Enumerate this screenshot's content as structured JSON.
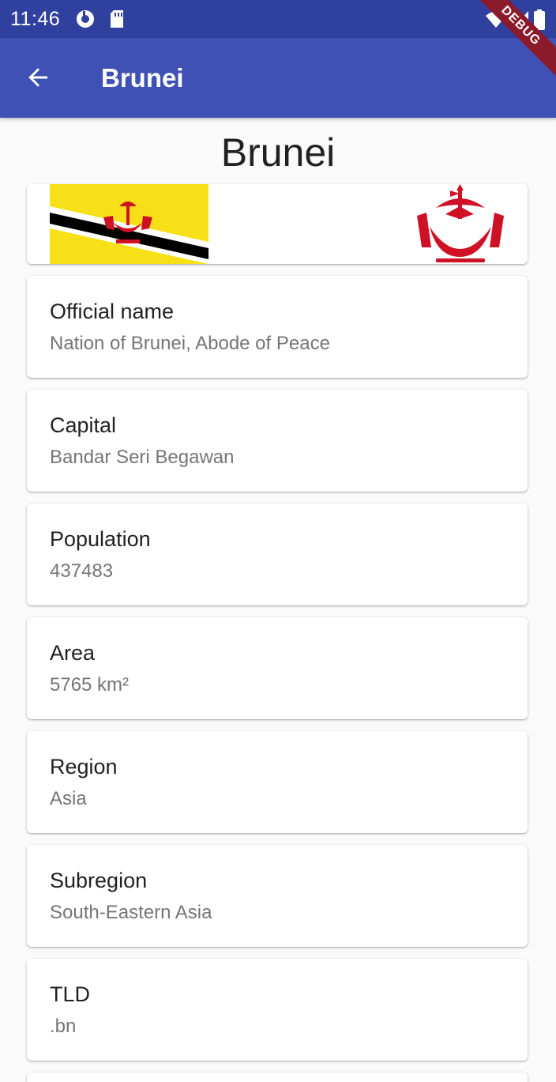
{
  "status_bar": {
    "time": "11:46"
  },
  "app_bar": {
    "title": "Brunei"
  },
  "debug_banner": "DEBUG",
  "heading": "Brunei",
  "fields": [
    {
      "label": "Official name",
      "value": "Nation of Brunei, Abode of Peace"
    },
    {
      "label": "Capital",
      "value": "Bandar Seri Begawan"
    },
    {
      "label": "Population",
      "value": "437483"
    },
    {
      "label": "Area",
      "value": "5765 km²"
    },
    {
      "label": "Region",
      "value": "Asia"
    },
    {
      "label": "Subregion",
      "value": "South-Eastern Asia"
    },
    {
      "label": "TLD",
      "value": ".bn"
    }
  ],
  "colors": {
    "status_bar": "#30409f",
    "app_bar": "#3f51b5",
    "flag_yellow": "#f7e017",
    "flag_black": "#000000",
    "flag_white": "#ffffff",
    "emblem_red": "#cf1126"
  }
}
